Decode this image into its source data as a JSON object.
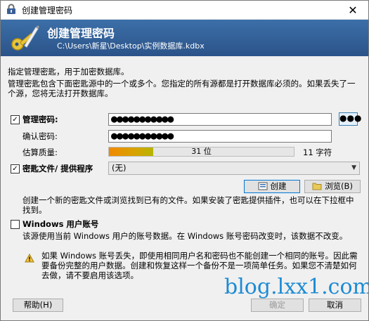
{
  "window": {
    "title": "创建管理密码",
    "icon": "lock-icon",
    "close_icon": "close-icon"
  },
  "banner": {
    "heading": "创建管理密码",
    "path": "C:\\Users\\新星\\Desktop\\实例数据库.kdbx",
    "icon": "key-icon"
  },
  "intro": {
    "line1": "指定管理密匙，用于加密数据库。",
    "line2": "管理密匙包含下面密匙源中的一个或多个。您指定的所有源都是打开数据库必须的。如果丢失了一个源，您将无法打开数据库。"
  },
  "password": {
    "checked": true,
    "label": "管理密码:",
    "value": "●●●●●●●●●●●",
    "reveal_label": "●●●",
    "confirm_label": "确认密码:",
    "confirm_value": "●●●●●●●●●●●",
    "quality_label": "估算质量:",
    "quality_text": "31 位",
    "quality_percent": 24,
    "chars_text": "11 字符"
  },
  "keyfile": {
    "checked": true,
    "label": "密匙文件/ 提供程序",
    "selected": "(无)",
    "create_label": "创建",
    "browse_label": "浏览(B)",
    "description": "创建一个新的密匙文件或浏览找到已有的文件。如果安装了密匙提供插件，也可以在下拉框中找到。"
  },
  "windows_account": {
    "checked": false,
    "label": "Windows 用户账号",
    "description": "该源使用当前 Windows 用户的账号数据。在 Windows 账号密码改变时，该数据不改变。",
    "warning": "如果 Windows 账号丢失，即使用相同用户名和密码也不能创建一个相同的账号。因此需要备份完整的用户数据。创建和恢复这样一个备份不是一项简单任务。如果您不清楚如何去做，请不要启用该选项。"
  },
  "footer": {
    "help_label": "帮助(H)",
    "ok_label": "确定",
    "cancel_label": "取消"
  },
  "watermark": "blog.lxx1.com",
  "colors": {
    "banner": "#2b5389",
    "progress_fill": "#f08a00",
    "watermark": "#1d8bd4"
  }
}
